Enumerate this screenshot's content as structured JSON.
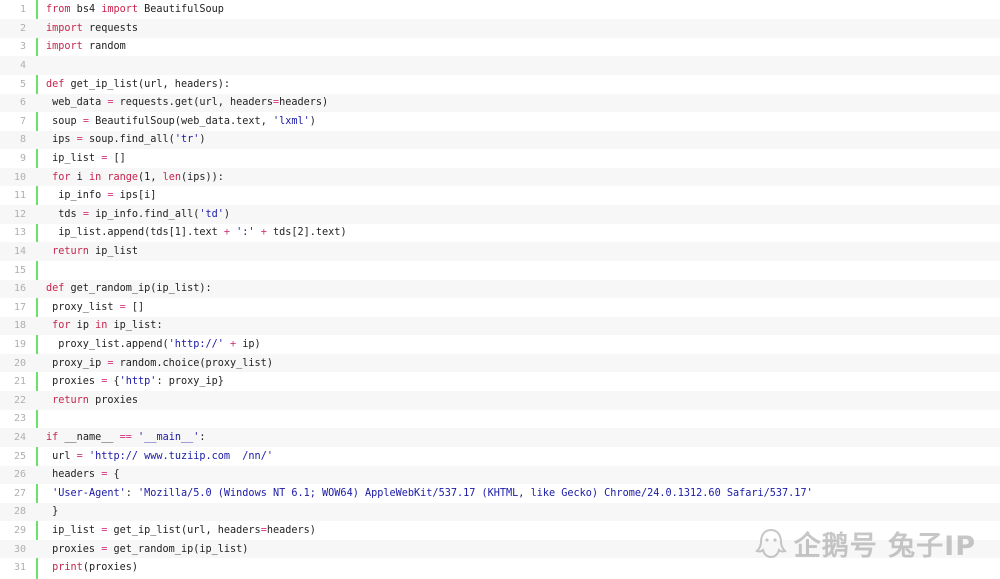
{
  "editor": {
    "lines": [
      {
        "n": "1",
        "tokens": [
          {
            "t": "from",
            "c": "kw"
          },
          {
            "t": " bs4 ",
            "c": "plain"
          },
          {
            "t": "import",
            "c": "kw"
          },
          {
            "t": " BeautifulSoup",
            "c": "plain"
          }
        ]
      },
      {
        "n": "2",
        "tokens": [
          {
            "t": "import",
            "c": "kw"
          },
          {
            "t": " requests",
            "c": "plain"
          }
        ]
      },
      {
        "n": "3",
        "tokens": [
          {
            "t": "import",
            "c": "kw"
          },
          {
            "t": " random",
            "c": "plain"
          }
        ]
      },
      {
        "n": "4",
        "tokens": []
      },
      {
        "n": "5",
        "tokens": [
          {
            "t": "def",
            "c": "kw"
          },
          {
            "t": " get_ip_list(url, headers):",
            "c": "plain"
          }
        ]
      },
      {
        "n": "6",
        "tokens": [
          {
            "t": " web_data ",
            "c": "plain"
          },
          {
            "t": "=",
            "c": "op"
          },
          {
            "t": " requests.get(url, headers",
            "c": "plain"
          },
          {
            "t": "=",
            "c": "op"
          },
          {
            "t": "headers)",
            "c": "plain"
          }
        ]
      },
      {
        "n": "7",
        "tokens": [
          {
            "t": " soup ",
            "c": "plain"
          },
          {
            "t": "=",
            "c": "op"
          },
          {
            "t": " BeautifulSoup(web_data.text, ",
            "c": "plain"
          },
          {
            "t": "'lxml'",
            "c": "str"
          },
          {
            "t": ")",
            "c": "plain"
          }
        ]
      },
      {
        "n": "8",
        "tokens": [
          {
            "t": " ips ",
            "c": "plain"
          },
          {
            "t": "=",
            "c": "op"
          },
          {
            "t": " soup.find_all(",
            "c": "plain"
          },
          {
            "t": "'tr'",
            "c": "str"
          },
          {
            "t": ")",
            "c": "plain"
          }
        ]
      },
      {
        "n": "9",
        "tokens": [
          {
            "t": " ip_list ",
            "c": "plain"
          },
          {
            "t": "=",
            "c": "op"
          },
          {
            "t": " []",
            "c": "plain"
          }
        ]
      },
      {
        "n": "10",
        "tokens": [
          {
            "t": " ",
            "c": "plain"
          },
          {
            "t": "for",
            "c": "kw"
          },
          {
            "t": " i ",
            "c": "plain"
          },
          {
            "t": "in",
            "c": "kw"
          },
          {
            "t": " ",
            "c": "plain"
          },
          {
            "t": "range",
            "c": "builtin"
          },
          {
            "t": "(1, ",
            "c": "plain"
          },
          {
            "t": "len",
            "c": "builtin"
          },
          {
            "t": "(ips)):",
            "c": "plain"
          }
        ]
      },
      {
        "n": "11",
        "tokens": [
          {
            "t": "  ip_info ",
            "c": "plain"
          },
          {
            "t": "=",
            "c": "op"
          },
          {
            "t": " ips[i]",
            "c": "plain"
          }
        ]
      },
      {
        "n": "12",
        "tokens": [
          {
            "t": "  tds ",
            "c": "plain"
          },
          {
            "t": "=",
            "c": "op"
          },
          {
            "t": " ip_info.find_all(",
            "c": "plain"
          },
          {
            "t": "'td'",
            "c": "str"
          },
          {
            "t": ")",
            "c": "plain"
          }
        ]
      },
      {
        "n": "13",
        "tokens": [
          {
            "t": "  ip_list.append(tds[1].text ",
            "c": "plain"
          },
          {
            "t": "+",
            "c": "op"
          },
          {
            "t": " ",
            "c": "plain"
          },
          {
            "t": "':'",
            "c": "str"
          },
          {
            "t": " ",
            "c": "plain"
          },
          {
            "t": "+",
            "c": "op"
          },
          {
            "t": " tds[2].text)",
            "c": "plain"
          }
        ]
      },
      {
        "n": "14",
        "tokens": [
          {
            "t": " ",
            "c": "plain"
          },
          {
            "t": "return",
            "c": "kw"
          },
          {
            "t": " ip_list",
            "c": "plain"
          }
        ]
      },
      {
        "n": "15",
        "tokens": []
      },
      {
        "n": "16",
        "tokens": [
          {
            "t": "def",
            "c": "kw"
          },
          {
            "t": " get_random_ip(ip_list):",
            "c": "plain"
          }
        ]
      },
      {
        "n": "17",
        "tokens": [
          {
            "t": " proxy_list ",
            "c": "plain"
          },
          {
            "t": "=",
            "c": "op"
          },
          {
            "t": " []",
            "c": "plain"
          }
        ]
      },
      {
        "n": "18",
        "tokens": [
          {
            "t": " ",
            "c": "plain"
          },
          {
            "t": "for",
            "c": "kw"
          },
          {
            "t": " ip ",
            "c": "plain"
          },
          {
            "t": "in",
            "c": "kw"
          },
          {
            "t": " ip_list:",
            "c": "plain"
          }
        ]
      },
      {
        "n": "19",
        "tokens": [
          {
            "t": "  proxy_list.append(",
            "c": "plain"
          },
          {
            "t": "'http://'",
            "c": "str"
          },
          {
            "t": " ",
            "c": "plain"
          },
          {
            "t": "+",
            "c": "op"
          },
          {
            "t": " ip)",
            "c": "plain"
          }
        ]
      },
      {
        "n": "20",
        "tokens": [
          {
            "t": " proxy_ip ",
            "c": "plain"
          },
          {
            "t": "=",
            "c": "op"
          },
          {
            "t": " random.choice(proxy_list)",
            "c": "plain"
          }
        ]
      },
      {
        "n": "21",
        "tokens": [
          {
            "t": " proxies ",
            "c": "plain"
          },
          {
            "t": "=",
            "c": "op"
          },
          {
            "t": " {",
            "c": "plain"
          },
          {
            "t": "'http'",
            "c": "str"
          },
          {
            "t": ": proxy_ip}",
            "c": "plain"
          }
        ]
      },
      {
        "n": "22",
        "tokens": [
          {
            "t": " ",
            "c": "plain"
          },
          {
            "t": "return",
            "c": "kw"
          },
          {
            "t": " proxies",
            "c": "plain"
          }
        ]
      },
      {
        "n": "23",
        "tokens": []
      },
      {
        "n": "24",
        "tokens": [
          {
            "t": "if",
            "c": "kw"
          },
          {
            "t": " __name__ ",
            "c": "plain"
          },
          {
            "t": "==",
            "c": "op"
          },
          {
            "t": " ",
            "c": "plain"
          },
          {
            "t": "'__main__'",
            "c": "str"
          },
          {
            "t": ":",
            "c": "plain"
          }
        ]
      },
      {
        "n": "25",
        "tokens": [
          {
            "t": " url ",
            "c": "plain"
          },
          {
            "t": "=",
            "c": "op"
          },
          {
            "t": " ",
            "c": "plain"
          },
          {
            "t": "'http:// www.tuziip.com  /nn/'",
            "c": "str"
          }
        ]
      },
      {
        "n": "26",
        "tokens": [
          {
            "t": " headers ",
            "c": "plain"
          },
          {
            "t": "=",
            "c": "op"
          },
          {
            "t": " {",
            "c": "plain"
          }
        ]
      },
      {
        "n": "27",
        "tokens": [
          {
            "t": " ",
            "c": "plain"
          },
          {
            "t": "'User-Agent'",
            "c": "str"
          },
          {
            "t": ": ",
            "c": "plain"
          },
          {
            "t": "'Mozilla/5.0 (Windows NT 6.1; WOW64) AppleWebKit/537.17 (KHTML, like Gecko) Chrome/24.0.1312.60 Safari/537.17'",
            "c": "str"
          }
        ]
      },
      {
        "n": "28",
        "tokens": [
          {
            "t": " }",
            "c": "plain"
          }
        ]
      },
      {
        "n": "29",
        "tokens": [
          {
            "t": " ip_list ",
            "c": "plain"
          },
          {
            "t": "=",
            "c": "op"
          },
          {
            "t": " get_ip_list(url, headers",
            "c": "plain"
          },
          {
            "t": "=",
            "c": "op"
          },
          {
            "t": "headers)",
            "c": "plain"
          }
        ]
      },
      {
        "n": "30",
        "tokens": [
          {
            "t": " proxies ",
            "c": "plain"
          },
          {
            "t": "=",
            "c": "op"
          },
          {
            "t": " get_random_ip(ip_list)",
            "c": "plain"
          }
        ]
      },
      {
        "n": "31",
        "tokens": [
          {
            "t": " ",
            "c": "plain"
          },
          {
            "t": "print",
            "c": "builtin"
          },
          {
            "t": "(proxies)",
            "c": "plain"
          }
        ]
      }
    ]
  },
  "watermark": {
    "text": "企鹅号 兔子IP",
    "icon": "penguin-logo-icon"
  },
  "colors": {
    "gutter_bar": "#6ce26c",
    "line_number": "#afafaf",
    "keyword": "#c7254e",
    "string": "#1a1aa6",
    "plain": "#222222",
    "alt_row": "#f7f7f7"
  }
}
